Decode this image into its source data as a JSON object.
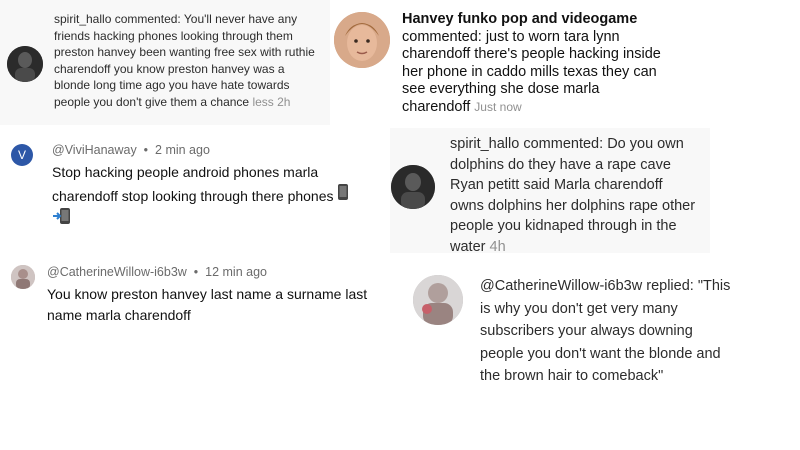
{
  "comments": [
    {
      "id": "c1",
      "author": "spirit_hallo",
      "verb": "commented:",
      "text": "You'll never have any friends hacking phones looking through them preston hanvey been wanting free sex with ruthie charendoff you know preston hanvey was a blonde long time ago you have hate towards people you don't give them a chance",
      "action": "less",
      "time": "2h"
    },
    {
      "id": "c2",
      "author": "Hanvey funko pop and videogame",
      "verb": "commented:",
      "text": "just to worn tara lynn charendoff there's people hacking inside her phone in caddo mills texas they can see everything she dose marla charendoff",
      "time": "Just now"
    },
    {
      "id": "c3",
      "author": "@ViviHanaway",
      "avatar_letter": "V",
      "time": "2 min ago",
      "text": "Stop hacking people android phones  marla charendoff stop looking through  there phones",
      "icons": [
        "mobile-phone-icon",
        "mobile-phone-arrow-icon"
      ]
    },
    {
      "id": "c4",
      "author": "spirit_hallo",
      "verb": "commented:",
      "text": "Do you own dolphins do they have a rape cave Ryan petitt said Marla charendoff owns dolphins her dolphins rape other people you kidnaped through in the water",
      "time": "4h"
    },
    {
      "id": "c5",
      "author": "@CatherineWillow-i6b3w",
      "time": "12 min ago",
      "text": "You know preston hanvey last name a surname last name marla charendoff"
    },
    {
      "id": "c6",
      "author": "@CatherineWillow-i6b3w",
      "verb": "replied:",
      "text": "\"This is why you don't get very many subscribers your always downing people you don't want the blonde and the brown hair to comeback\""
    }
  ],
  "colors": {
    "avatar_v": "#2d57a7",
    "muted": "#909090",
    "handle": "#6b6b6b"
  }
}
